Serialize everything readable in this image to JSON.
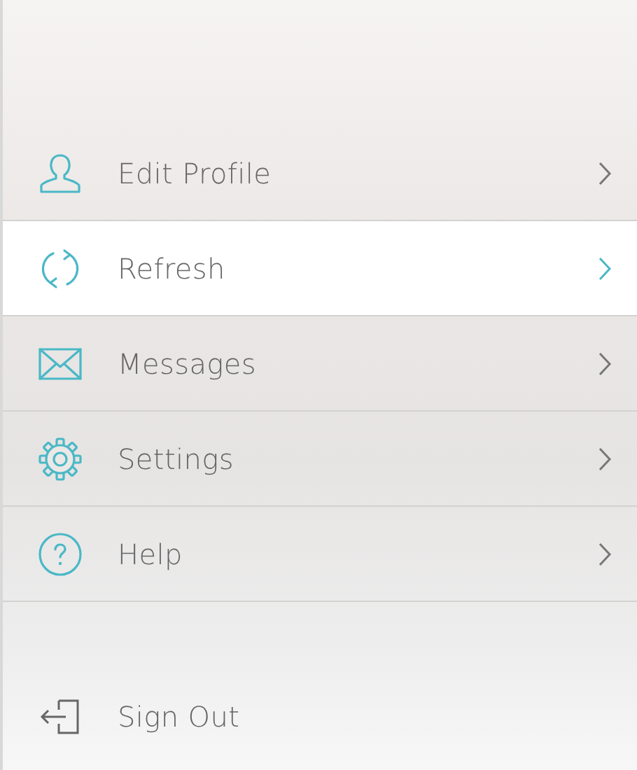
{
  "menu": [
    {
      "kind": "profile",
      "label": "Edit Profile",
      "selected": false
    },
    {
      "kind": "refresh",
      "label": "Refresh",
      "selected": true
    },
    {
      "kind": "messages",
      "label": "Messages",
      "selected": false
    },
    {
      "kind": "settings",
      "label": "Settings",
      "selected": false
    },
    {
      "kind": "help",
      "label": "Help",
      "selected": false
    }
  ],
  "sign_out": {
    "label": "Sign Out"
  }
}
